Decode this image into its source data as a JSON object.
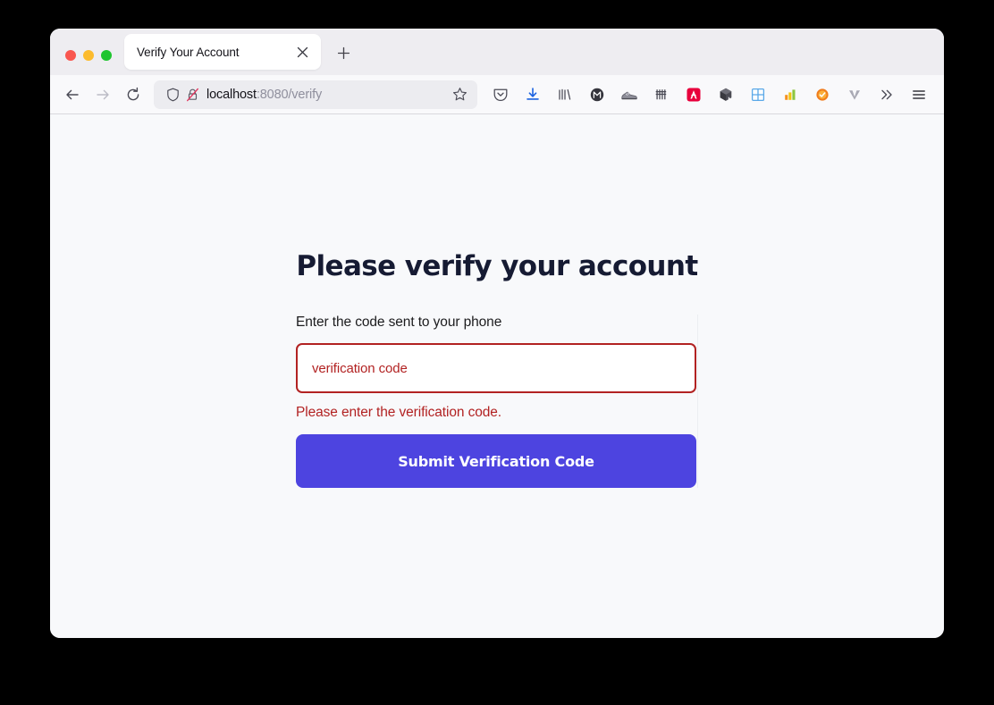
{
  "window": {
    "traffic_lights": [
      {
        "name": "close",
        "color": "#f9564f"
      },
      {
        "name": "minimize",
        "color": "#fcbb2d"
      },
      {
        "name": "maximize",
        "color": "#1fc52f"
      }
    ]
  },
  "tabs": {
    "active": {
      "title": "Verify Your Account"
    },
    "close_icon": "close-icon",
    "new_tab_icon": "plus-icon"
  },
  "nav": {
    "back_icon": "back-arrow-icon",
    "forward_icon": "forward-arrow-icon",
    "reload_icon": "reload-icon"
  },
  "urlbar": {
    "shield_icon": "shield-icon",
    "lock_icon": "lock-slashed-icon",
    "host": "localhost",
    "path": ":8080/verify",
    "full_url": "localhost:8080/verify",
    "bookmark_icon": "star-icon"
  },
  "extensions": [
    {
      "name": "pocket-icon",
      "label": "Pocket"
    },
    {
      "name": "downloads-icon",
      "label": "Downloads"
    },
    {
      "name": "library-icon",
      "label": "Library"
    },
    {
      "name": "metamask-icon",
      "label": "MetaMask"
    },
    {
      "name": "sneaker-icon",
      "label": "Sneaker"
    },
    {
      "name": "barcode-icon",
      "label": "Barcode"
    },
    {
      "name": "adobe-acrobat-icon",
      "label": "Adobe Acrobat"
    },
    {
      "name": "cube-icon",
      "label": "Cube"
    },
    {
      "name": "grid-icon",
      "label": "Grid"
    },
    {
      "name": "bar-chart-icon",
      "label": "Bar Chart"
    },
    {
      "name": "checkmark-badge-icon",
      "label": "Checkmark Badge"
    },
    {
      "name": "v-icon",
      "label": "V"
    },
    {
      "name": "overflow-chevrons-icon",
      "label": "More tools"
    },
    {
      "name": "hamburger-menu-icon",
      "label": "Open application menu"
    }
  ],
  "page": {
    "heading": "Please verify your account",
    "label": "Enter the code sent to your phone",
    "input_placeholder": "verification code",
    "input_value": "",
    "error": "Please enter the verification code.",
    "submit_label": "Submit Verification Code"
  },
  "colors": {
    "accent": "#4d44e0",
    "error": "#b22222",
    "page_bg": "#f8f9fb",
    "heading": "#161b33",
    "tabbar_bg": "#eeedf1",
    "urlbar_bg": "#ececf0"
  }
}
